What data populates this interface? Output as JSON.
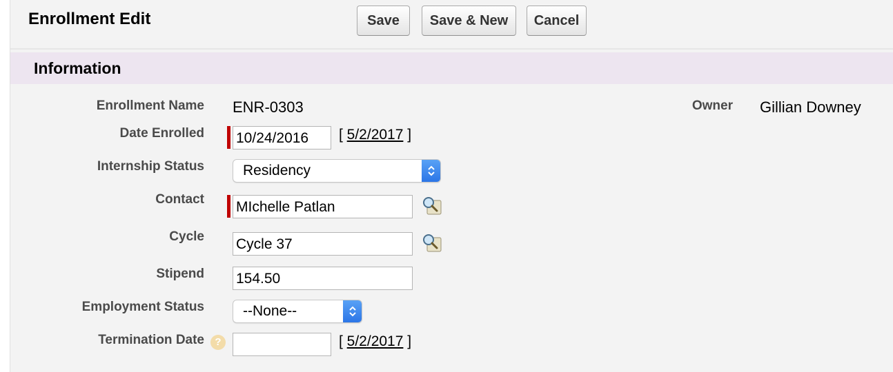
{
  "header": {
    "title": "Enrollment Edit",
    "save_label": "Save",
    "save_new_label": "Save & New",
    "cancel_label": "Cancel"
  },
  "section": {
    "title": "Information"
  },
  "fields": {
    "enrollment_name": {
      "label": "Enrollment Name",
      "value": "ENR-0303"
    },
    "owner": {
      "label": "Owner",
      "value": "Gillian Downey"
    },
    "date_enrolled": {
      "label": "Date Enrolled",
      "value": "10/24/2016",
      "today_link": "5/2/2017",
      "required": true
    },
    "internship_status": {
      "label": "Internship Status",
      "selected": "Residency"
    },
    "contact": {
      "label": "Contact",
      "value": "MIchelle Patlan",
      "required": true
    },
    "cycle": {
      "label": "Cycle",
      "value": "Cycle 37"
    },
    "stipend": {
      "label": "Stipend",
      "value": "154.50"
    },
    "employment_status": {
      "label": "Employment Status",
      "selected": "--None--"
    },
    "termination_date": {
      "label": "Termination Date",
      "value": "",
      "today_link": "5/2/2017"
    }
  },
  "brackets": {
    "open": "[ ",
    "close": " ]"
  },
  "icons": {
    "lookup": "magnifier-lookup-icon",
    "help": "help-icon",
    "select_arrows": "select-updown-icon"
  },
  "colors": {
    "required_bar": "#c00000",
    "section_bar": "#ede5f0",
    "select_accent": "#2a74e6"
  }
}
